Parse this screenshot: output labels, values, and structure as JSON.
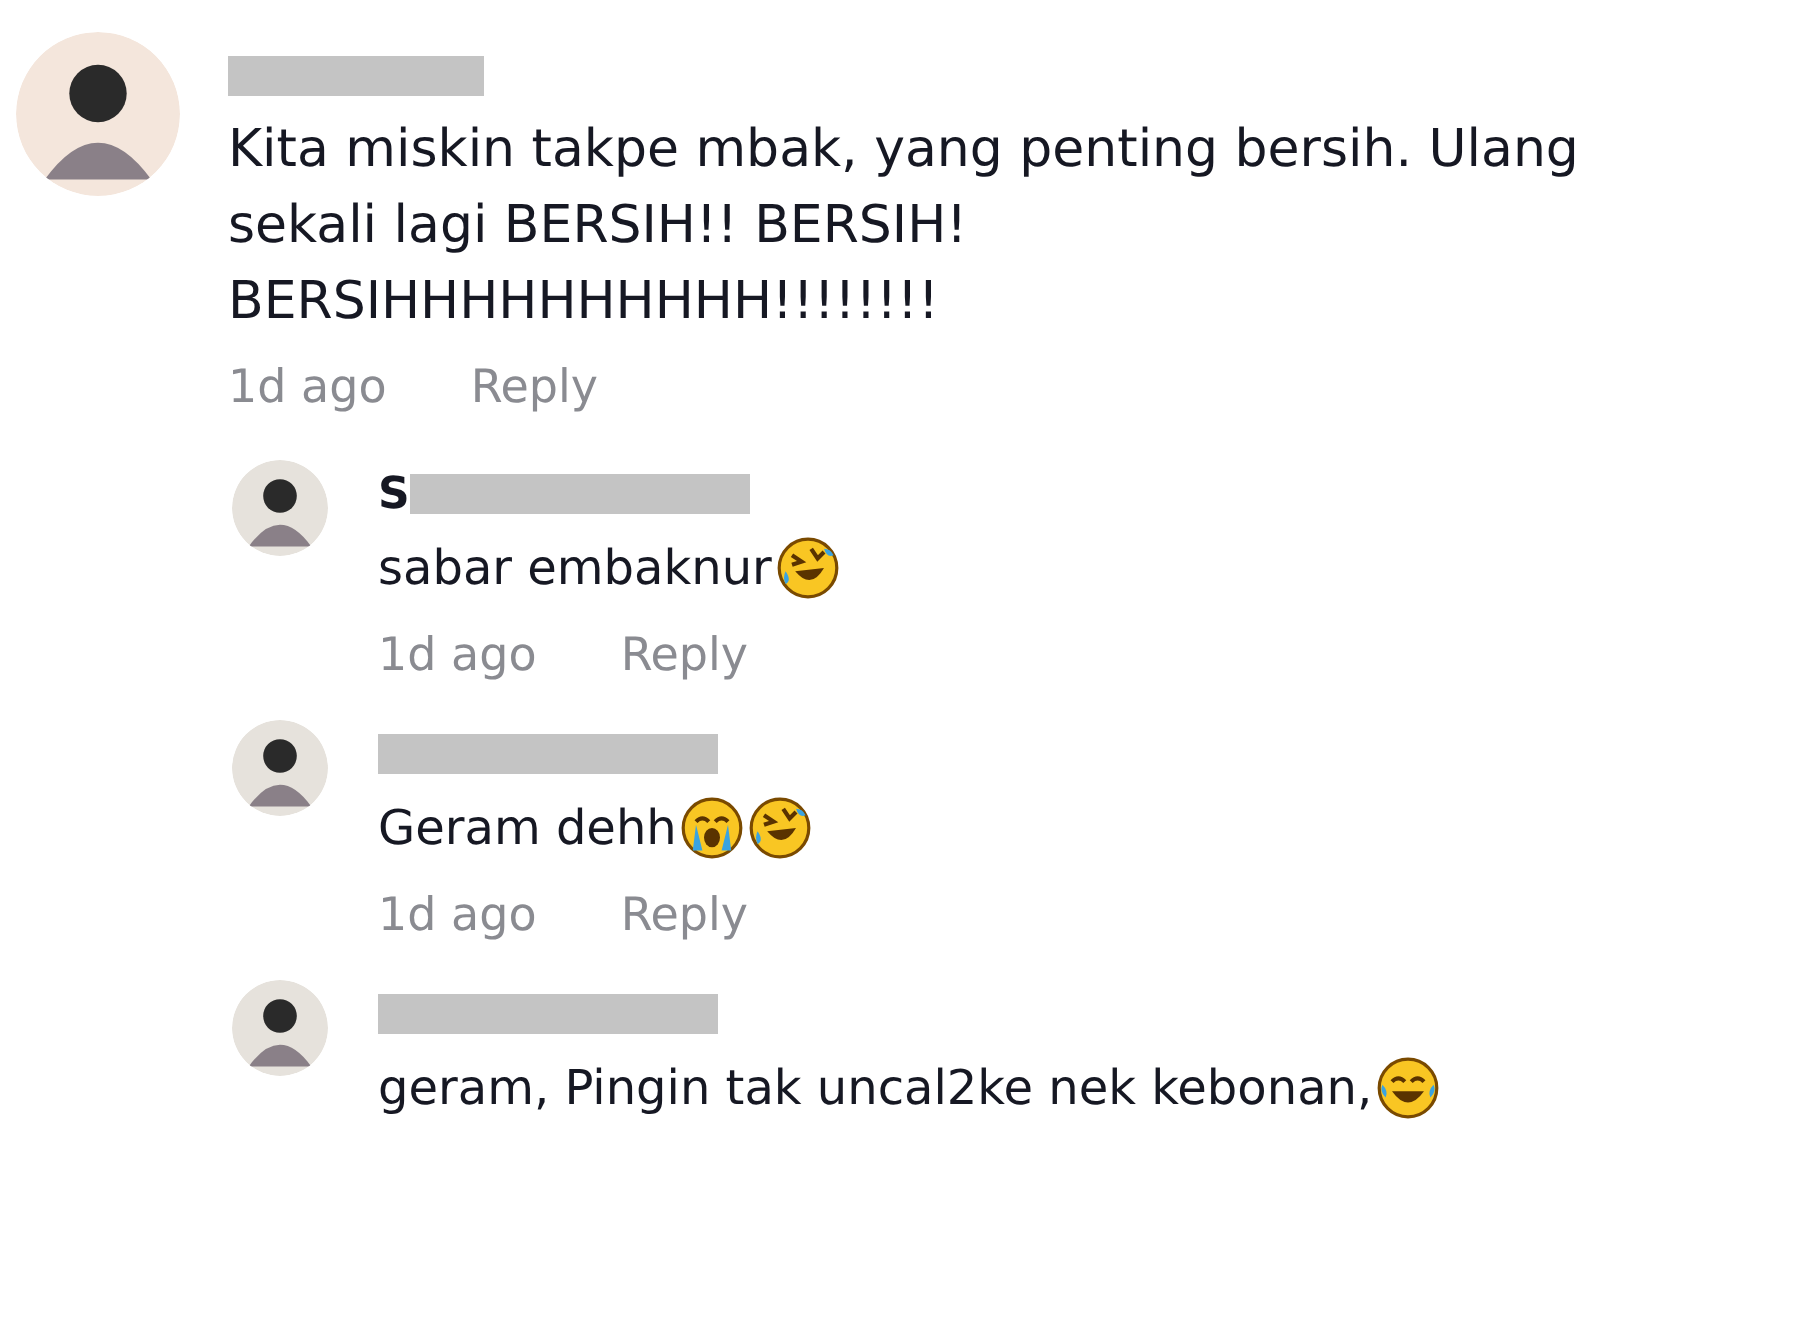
{
  "comment": {
    "name_redacted": true,
    "text": "Kita miskin takpe mbak, yang penting bersih. Ulang sekali lagi BERSIH!! BERSIH! BERSIHHHHHHHHHH!!!!!!!!",
    "time": "1d ago",
    "reply": "Reply",
    "replies": [
      {
        "name_visible": "S",
        "name_redacted": true,
        "text": "sabar embaknur",
        "icons": [
          {
            "kind": "rofl"
          }
        ],
        "time": "1d ago",
        "reply": "Reply"
      },
      {
        "name_redacted": true,
        "text": "Geram dehh",
        "icons": [
          {
            "kind": "sob"
          },
          {
            "kind": "rofl"
          }
        ],
        "time": "1d ago",
        "reply": "Reply"
      },
      {
        "name_redacted": true,
        "text": "geram, Pingin tak uncal2ke nek kebonan,",
        "icons": [
          {
            "kind": "joy"
          }
        ]
      }
    ]
  }
}
